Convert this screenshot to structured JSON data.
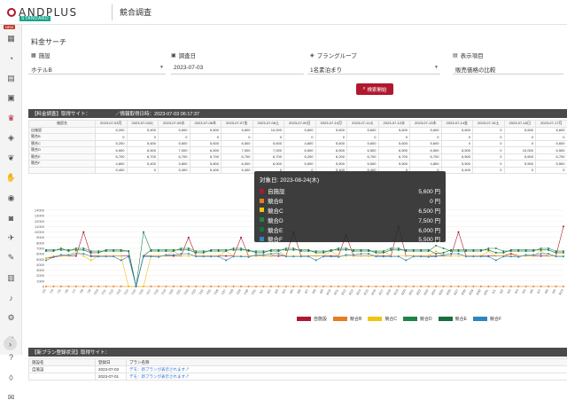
{
  "header": {
    "logo": "ANDPLUS",
    "logo_badge": "STANDARD",
    "title": "競合調査"
  },
  "sidebar": {
    "new_badge": "NEW",
    "items": [
      {
        "icon": "apps-grid-icon",
        "glyph": "▦"
      },
      {
        "icon": "gauge-icon",
        "glyph": "◔"
      },
      {
        "icon": "document-icon",
        "glyph": "▤"
      },
      {
        "icon": "calendar-icon",
        "glyph": "▣"
      },
      {
        "icon": "crown-icon",
        "glyph": "♛"
      },
      {
        "icon": "tag-icon",
        "glyph": "◈"
      },
      {
        "icon": "leaf-icon",
        "glyph": "❦"
      },
      {
        "icon": "hand-icon",
        "glyph": "✋"
      },
      {
        "icon": "user-icon",
        "glyph": "◉"
      },
      {
        "icon": "camera-icon",
        "glyph": "◙"
      },
      {
        "icon": "plane-icon",
        "glyph": "✈"
      },
      {
        "icon": "edit-icon",
        "glyph": "✎"
      },
      {
        "icon": "book-icon",
        "glyph": "▥"
      },
      {
        "icon": "bell-icon",
        "glyph": "♪"
      },
      {
        "icon": "gear-icon",
        "glyph": "⚙"
      },
      {
        "icon": "link-icon",
        "glyph": "∞"
      },
      {
        "icon": "help-icon",
        "glyph": "?"
      },
      {
        "icon": "shield-icon",
        "glyph": "◊"
      },
      {
        "icon": "mail-icon",
        "glyph": "✉"
      }
    ],
    "expand": "›"
  },
  "search": {
    "section_title": "料金サーチ",
    "facility_label": "施設",
    "facility_value": "ホテルB",
    "date_label": "調査日",
    "date_value": "2023-07-03",
    "plan_label": "プラングループ",
    "plan_value": "1名素泊まり",
    "display_label": "表示項目",
    "display_value": "販売価格の比較",
    "button": "検索開始"
  },
  "price_panel": {
    "title": "【料金調査】取得サイト：",
    "info": "／情報取得日時：2023-07-03 06:17:37",
    "columns": [
      "施設名",
      "2023-07-03月",
      "2023-07-04火",
      "2023-07-05水",
      "2023-07-06木",
      "2023-07-07金",
      "2023-07-08土",
      "2023-07-09日",
      "2023-07-10月",
      "2023-07-11火",
      "2023-07-12水",
      "2023-07-13木",
      "2023-07-14金",
      "2023-07-15土",
      "2023-07-16日",
      "2023-07-17月"
    ],
    "rows": [
      {
        "name": "自施設",
        "cells": [
          "5,200",
          "5,400",
          "5,600",
          "5,600",
          "5,600",
          "10,000",
          "5,600",
          "5,600",
          "5,600",
          "5,600",
          "5,600",
          "5,600",
          "0",
          "5,600",
          "5,600"
        ]
      },
      {
        "name": "競合B",
        "cells": [
          "0",
          "0",
          "0",
          "0",
          "0",
          "0",
          "0",
          "0",
          "0",
          "0",
          "0",
          "0",
          "0",
          "0",
          "0"
        ]
      },
      {
        "name": "競合C",
        "cells": [
          "5,200",
          "5,600",
          "5,600",
          "5,600",
          "6,500",
          "5,600",
          "4,800",
          "5,600",
          "5,600",
          "5,600",
          "5,600",
          "0",
          "0",
          "0",
          "5,600"
        ]
      },
      {
        "name": "競合D",
        "cells": [
          "6,500",
          "6,500",
          "7,000",
          "6,500",
          "7,000",
          "7,000",
          "6,500",
          "6,500",
          "6,500",
          "6,500",
          "6,500",
          "6,500",
          "0",
          "10,000",
          "6,500"
        ]
      },
      {
        "name": "競合E",
        "cells": [
          "6,700",
          "6,700",
          "6,700",
          "6,700",
          "6,700",
          "6,700",
          "6,200",
          "6,200",
          "6,700",
          "6,700",
          "6,700",
          "6,500",
          "0",
          "5,600",
          "6,700"
        ]
      },
      {
        "name": "競合F",
        "cells": [
          "4,800",
          "5,400",
          "5,800",
          "5,800",
          "6,000",
          "6,000",
          "5,500",
          "5,500",
          "5,500",
          "5,500",
          "4,800",
          "5,500",
          "0",
          "5,500",
          "5,500"
        ]
      },
      {
        "name": "",
        "cells": [
          "5,400",
          "0",
          "5,400",
          "5,400",
          "5,400",
          "0",
          "0",
          "5,400",
          "5,400",
          "0",
          "0",
          "5,400",
          "0",
          "0",
          "0"
        ]
      }
    ]
  },
  "tooltip": {
    "title": "対象日: 2023-08-24(木)",
    "rows": [
      {
        "name": "自施設",
        "value": "5,600 円",
        "color": "#b0182e"
      },
      {
        "name": "競合B",
        "value": "0 円",
        "color": "#e67e22"
      },
      {
        "name": "競合C",
        "value": "6,500 円",
        "color": "#f1c40f"
      },
      {
        "name": "競合D",
        "value": "7,500 円",
        "color": "#1e8449"
      },
      {
        "name": "競合E",
        "value": "6,000 円",
        "color": "#196f3d"
      },
      {
        "name": "競合F",
        "value": "5,500 円",
        "color": "#2e86c1"
      }
    ]
  },
  "chart_data": {
    "type": "line",
    "ylim": [
      0,
      14000
    ],
    "yticks": [
      "14000",
      "13000",
      "12000",
      "11000",
      "10000",
      "9000",
      "8000",
      "7000",
      "6000",
      "5000",
      "4000",
      "3000",
      "2000",
      "1000",
      "0"
    ],
    "xlabels": [
      "7/3",
      "7/4",
      "7/5",
      "7/6",
      "7/7",
      "7/8",
      "7/9",
      "7/10",
      "7/11",
      "7/12",
      "7/13",
      "7/14",
      "7/15",
      "7/16",
      "7/17",
      "7/18",
      "7/19",
      "7/20",
      "7/21",
      "7/22",
      "7/23",
      "7/24",
      "7/25",
      "7/26",
      "7/27",
      "7/28",
      "7/29",
      "7/30",
      "7/31",
      "8/1",
      "8/2",
      "8/3",
      "8/4",
      "8/5",
      "8/6",
      "8/7",
      "8/8",
      "8/9",
      "8/10",
      "8/11",
      "8/12",
      "8/13",
      "8/14",
      "8/15",
      "8/16",
      "8/17",
      "8/18",
      "8/19",
      "8/20",
      "8/21",
      "8/22",
      "8/23",
      "8/24",
      "8/25",
      "8/26",
      "8/27",
      "8/28",
      "8/29",
      "8/30",
      "8/31",
      "9/1",
      "9/2",
      "9/3",
      "9/4",
      "9/5",
      "9/6",
      "9/7",
      "9/8",
      "9/9",
      "9/10"
    ],
    "series": [
      {
        "name": "自施設",
        "color": "#b0182e",
        "values": [
          5200,
          5400,
          5600,
          5600,
          5600,
          10000,
          5600,
          5600,
          5600,
          5600,
          5600,
          5600,
          0,
          5600,
          5600,
          5600,
          5600,
          5600,
          5600,
          9000,
          5600,
          5600,
          5600,
          5600,
          5600,
          5600,
          9000,
          5600,
          5600,
          5600,
          5600,
          5600,
          5600,
          10000,
          5600,
          5600,
          5600,
          5600,
          5600,
          5600,
          9500,
          5600,
          5600,
          5600,
          5600,
          5600,
          5600,
          11000,
          5600,
          5600,
          5600,
          5600,
          5600,
          5600,
          5600,
          10000,
          5600,
          5600,
          5600,
          5600,
          5600,
          5600,
          6000,
          5600,
          5600,
          5600,
          5600,
          5600,
          5600,
          11000
        ]
      },
      {
        "name": "競合B",
        "color": "#e67e22",
        "values": [
          0,
          0,
          0,
          0,
          0,
          0,
          0,
          0,
          0,
          0,
          0,
          0,
          0,
          0,
          0,
          0,
          0,
          0,
          0,
          0,
          0,
          0,
          0,
          0,
          0,
          0,
          0,
          0,
          0,
          0,
          0,
          0,
          0,
          0,
          0,
          0,
          0,
          0,
          0,
          0,
          0,
          0,
          0,
          0,
          0,
          0,
          0,
          0,
          0,
          0,
          0,
          0,
          0,
          0,
          0,
          0,
          0,
          0,
          0,
          0,
          0,
          0,
          0,
          0,
          0,
          0,
          0,
          0,
          0,
          0
        ]
      },
      {
        "name": "競合C",
        "color": "#f1c40f",
        "values": [
          5200,
          5600,
          5600,
          5600,
          6500,
          5600,
          4800,
          5600,
          5600,
          5600,
          5600,
          0,
          0,
          0,
          5600,
          5600,
          5600,
          6500,
          5600,
          5600,
          5600,
          5600,
          5600,
          5600,
          6500,
          5600,
          5600,
          5600,
          5600,
          5600,
          5600,
          6500,
          5600,
          5600,
          5600,
          5600,
          5600,
          5600,
          6500,
          5600,
          5600,
          5600,
          5600,
          5600,
          5600,
          6500,
          5600,
          5600,
          5600,
          5600,
          5600,
          5600,
          6500,
          5600,
          5600,
          5600,
          5600,
          5600,
          5600,
          6500,
          5600,
          5600,
          5600,
          5600,
          5600,
          5600,
          6500,
          5600,
          5600,
          5600
        ]
      },
      {
        "name": "競合D",
        "color": "#1e8449",
        "values": [
          6500,
          6500,
          7000,
          6500,
          7000,
          7000,
          6500,
          6500,
          6500,
          6500,
          6500,
          6500,
          0,
          10000,
          6500,
          6500,
          6500,
          6500,
          7000,
          7000,
          6500,
          6500,
          6500,
          6500,
          6500,
          7000,
          7000,
          6500,
          6500,
          6500,
          6500,
          6500,
          7000,
          7000,
          6500,
          6500,
          6500,
          6500,
          6500,
          7000,
          7000,
          6500,
          6500,
          6500,
          6500,
          6500,
          7000,
          7000,
          6500,
          6500,
          6500,
          6500,
          7500,
          7000,
          6500,
          6500,
          6500,
          6500,
          6500,
          7000,
          7000,
          6500,
          6500,
          6500,
          6500,
          6500,
          7000,
          7000,
          6500,
          6500
        ]
      },
      {
        "name": "競合E",
        "color": "#196f3d",
        "values": [
          6700,
          6700,
          6700,
          6700,
          6700,
          6700,
          6200,
          6200,
          6700,
          6700,
          6700,
          6500,
          0,
          5600,
          6700,
          6700,
          6700,
          6700,
          6700,
          6700,
          6200,
          6200,
          6700,
          6700,
          6700,
          6700,
          6700,
          6700,
          6200,
          6200,
          6700,
          6700,
          6700,
          6700,
          6700,
          6700,
          6200,
          6200,
          6700,
          6700,
          6700,
          6700,
          6700,
          6700,
          6200,
          6200,
          6700,
          6700,
          6700,
          6700,
          6700,
          6700,
          6000,
          6200,
          6700,
          6700,
          6700,
          6700,
          6700,
          6700,
          6200,
          6200,
          6700,
          6700,
          6700,
          6700,
          6700,
          6700,
          6200,
          6200
        ]
      },
      {
        "name": "競合F",
        "color": "#2e86c1",
        "values": [
          4800,
          5400,
          5800,
          5800,
          6000,
          6000,
          5500,
          5500,
          5500,
          5500,
          4800,
          5500,
          0,
          5500,
          5500,
          5400,
          5800,
          5800,
          6000,
          6000,
          5500,
          5500,
          5500,
          5500,
          4800,
          5500,
          5500,
          5400,
          5800,
          5800,
          6000,
          6000,
          5500,
          5500,
          5500,
          5500,
          4800,
          5500,
          5500,
          5400,
          5800,
          5800,
          6000,
          6000,
          5500,
          5500,
          5500,
          5500,
          4800,
          5500,
          5500,
          5400,
          5500,
          5800,
          6000,
          6000,
          5500,
          5500,
          5500,
          5500,
          4800,
          5500,
          5500,
          5400,
          5800,
          5800,
          6000,
          6000,
          5500,
          5500
        ]
      }
    ]
  },
  "new_plan_panel": {
    "title": "【新プラン登録状況】取得サイト：",
    "columns": [
      "施設名",
      "登録日",
      "プラン名称"
    ],
    "rows": [
      {
        "name": "自施設",
        "date": "2023-07-03",
        "plan": "デモ：新プランが表示されます"
      },
      {
        "name": "",
        "date": "2023-07-01",
        "plan": "デモ：新プランが表示されます"
      }
    ]
  }
}
